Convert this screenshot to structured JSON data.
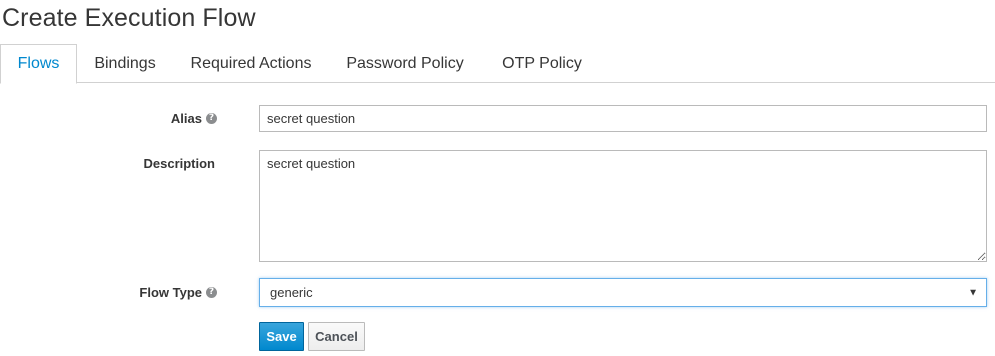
{
  "page": {
    "title": "Create Execution Flow"
  },
  "tabs": [
    {
      "label": "Flows",
      "active": true
    },
    {
      "label": "Bindings",
      "active": false
    },
    {
      "label": "Required Actions",
      "active": false
    },
    {
      "label": "Password Policy",
      "active": false
    },
    {
      "label": "OTP Policy",
      "active": false
    }
  ],
  "form": {
    "alias": {
      "label": "Alias",
      "value": "secret question",
      "has_help_icon": true
    },
    "description": {
      "label": "Description",
      "value": "secret question"
    },
    "flow_type": {
      "label": "Flow Type",
      "selected": "generic",
      "has_help_icon": true
    },
    "save_label": "Save",
    "cancel_label": "Cancel"
  },
  "colors": {
    "accent": "#0088ce",
    "primary_button": "#0088ce",
    "focus_border": "#66afe9"
  },
  "icons": {
    "help": "question-circle-icon",
    "select_caret": "caret-down-icon"
  }
}
